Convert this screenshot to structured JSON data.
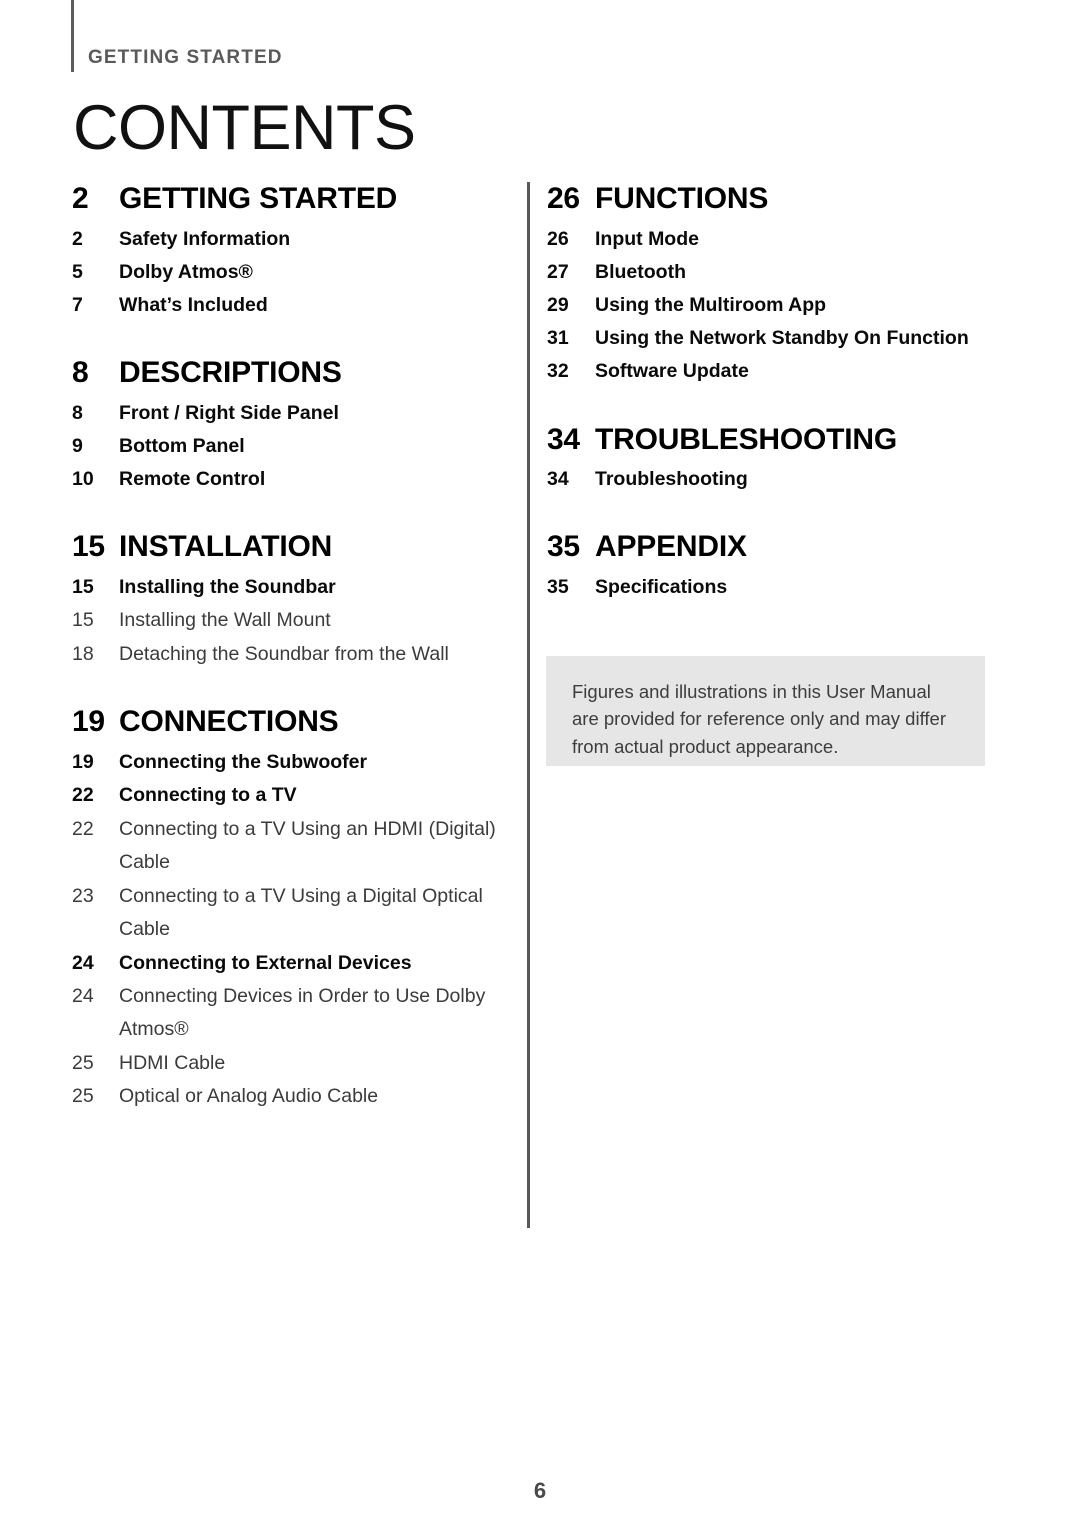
{
  "header": {
    "eyebrow": "GETTING STARTED",
    "title": "CONTENTS"
  },
  "columns": {
    "left": [
      {
        "level": 1,
        "page": "2",
        "label": "GETTING STARTED"
      },
      {
        "level": 2,
        "page": "2",
        "label": "Safety Information"
      },
      {
        "level": 2,
        "page": "5",
        "label": "Dolby Atmos®"
      },
      {
        "level": 2,
        "page": "7",
        "label": "What’s Included"
      },
      {
        "level": 1,
        "page": "8",
        "label": "DESCRIPTIONS"
      },
      {
        "level": 2,
        "page": "8",
        "label": "Front / Right Side Panel"
      },
      {
        "level": 2,
        "page": "9",
        "label": "Bottom Panel"
      },
      {
        "level": 2,
        "page": "10",
        "label": "Remote Control"
      },
      {
        "level": 1,
        "page": "15",
        "label": "INSTALLATION"
      },
      {
        "level": 2,
        "page": "15",
        "label": "Installing the Soundbar"
      },
      {
        "level": 3,
        "page": "15",
        "label": "Installing the Wall Mount"
      },
      {
        "level": 3,
        "page": "18",
        "label": "Detaching the Soundbar from the Wall"
      },
      {
        "level": 1,
        "page": "19",
        "label": "CONNECTIONS"
      },
      {
        "level": 2,
        "page": "19",
        "label": "Connecting the Subwoofer"
      },
      {
        "level": 2,
        "page": "22",
        "label": "Connecting to a TV"
      },
      {
        "level": 3,
        "page": "22",
        "label": "Connecting to a TV Using an HDMI (Digital) Cable"
      },
      {
        "level": 3,
        "page": "23",
        "label": "Connecting to a TV Using a Digital Optical Cable"
      },
      {
        "level": 2,
        "page": "24",
        "label": "Connecting to External Devices"
      },
      {
        "level": 3,
        "page": "24",
        "label": "Connecting Devices in Order to Use Dolby Atmos®"
      },
      {
        "level": 3,
        "page": "25",
        "label": "HDMI Cable"
      },
      {
        "level": 3,
        "page": "25",
        "label": "Optical or Analog Audio Cable"
      }
    ],
    "right": [
      {
        "level": 1,
        "page": "26",
        "label": "FUNCTIONS"
      },
      {
        "level": 2,
        "page": "26",
        "label": "Input Mode"
      },
      {
        "level": 2,
        "page": "27",
        "label": "Bluetooth"
      },
      {
        "level": 2,
        "page": "29",
        "label": "Using the Multiroom App"
      },
      {
        "level": 2,
        "page": "31",
        "label": "Using the Network Standby On Function"
      },
      {
        "level": 2,
        "page": "32",
        "label": "Software Update"
      },
      {
        "level": 1,
        "page": "34",
        "label": "TROUBLESHOOTING"
      },
      {
        "level": 2,
        "page": "34",
        "label": "Troubleshooting"
      },
      {
        "level": 1,
        "page": "35",
        "label": "APPENDIX"
      },
      {
        "level": 2,
        "page": "35",
        "label": "Specifications"
      }
    ]
  },
  "note": {
    "text": "Figures and illustrations in this User Manual are provided for reference only and may differ from actual product appearance."
  },
  "footer": {
    "page_number": "6"
  },
  "colors": {
    "text_primary": "#000000",
    "text_secondary": "#3b3b3b",
    "eyebrow": "#5a5a5a",
    "divider": "#585858",
    "note_background": "#e6e6e6",
    "page_background": "#ffffff"
  }
}
